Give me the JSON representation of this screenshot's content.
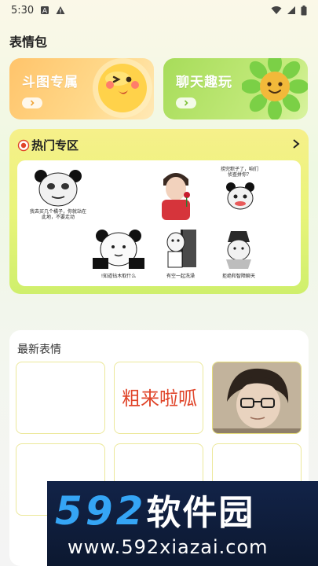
{
  "status_bar": {
    "time": "5:30"
  },
  "page": {
    "title": "表情包"
  },
  "cards": [
    {
      "title": "斗图专属",
      "icon": "emoji-face-icon"
    },
    {
      "title": "聊天趣玩",
      "icon": "flower-face-icon"
    }
  ],
  "hot": {
    "title": "热门专区",
    "stickers": [
      {
        "caption": "我去买几个橘子，你就站在此地，不要走动"
      },
      {
        "caption": ""
      },
      {
        "caption": "捞完粽子了，咱们侦查拼你？"
      },
      {
        "caption": "!知道钻木取什么"
      },
      {
        "caption": "有空一起洗澡"
      },
      {
        "caption": "拒绝和智障聊天"
      }
    ]
  },
  "latest": {
    "title": "最新表情",
    "items": [
      {
        "text": ""
      },
      {
        "text": "粗来啦呱"
      },
      {
        "text": ""
      },
      {
        "text": ""
      },
      {
        "text": ""
      },
      {
        "text": ""
      }
    ]
  },
  "watermark": {
    "num": "592",
    "cn": "软件园",
    "url": "www.592xiazai.com"
  },
  "colors": {
    "card_orange": "#ffc46b",
    "card_green": "#a7dc5a",
    "hot_yellow": "#f6f08a",
    "sticker_text_red": "#e0452a"
  }
}
